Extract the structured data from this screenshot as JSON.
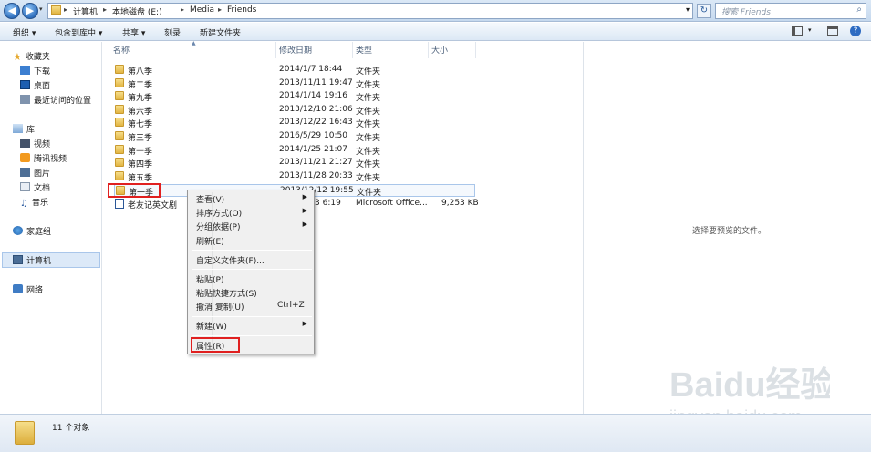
{
  "address": {
    "breadcrumbs": [
      "计算机",
      "本地磁盘 (E:)",
      "Media",
      "Friends"
    ],
    "search_placeholder": "搜索 Friends"
  },
  "toolbar": {
    "organize": "组织 ▾",
    "include": "包含到库中 ▾",
    "share": "共享 ▾",
    "burn": "刻录",
    "new_folder": "新建文件夹"
  },
  "nav": {
    "favorites": "收藏夹",
    "downloads": "下载",
    "desktop": "桌面",
    "recent": "最近访问的位置",
    "libraries": "库",
    "videos": "视频",
    "tencent_video": "腾讯视频",
    "pictures": "图片",
    "documents": "文档",
    "music": "音乐",
    "homegroup": "家庭组",
    "computer": "计算机",
    "network": "网络"
  },
  "columns": {
    "name": "名称",
    "modified": "修改日期",
    "type": "类型",
    "size": "大小"
  },
  "files": [
    {
      "name": "第八季",
      "date": "2014/1/7 18:44",
      "type": "文件夹",
      "size": ""
    },
    {
      "name": "第二季",
      "date": "2013/11/11 19:47",
      "type": "文件夹",
      "size": ""
    },
    {
      "name": "第九季",
      "date": "2014/1/14 19:16",
      "type": "文件夹",
      "size": ""
    },
    {
      "name": "第六季",
      "date": "2013/12/10 21:06",
      "type": "文件夹",
      "size": ""
    },
    {
      "name": "第七季",
      "date": "2013/12/22 16:43",
      "type": "文件夹",
      "size": ""
    },
    {
      "name": "第三季",
      "date": "2016/5/29 10:50",
      "type": "文件夹",
      "size": ""
    },
    {
      "name": "第十季",
      "date": "2014/1/25 21:07",
      "type": "文件夹",
      "size": ""
    },
    {
      "name": "第四季",
      "date": "2013/11/21 21:27",
      "type": "文件夹",
      "size": ""
    },
    {
      "name": "第五季",
      "date": "2013/11/28 20:33",
      "type": "文件夹",
      "size": ""
    },
    {
      "name": "第一季",
      "date": "2013/12/12 19:55",
      "type": "文件夹",
      "size": ""
    },
    {
      "name": "老友记英文剧",
      "date": "3 6:19",
      "type": "Microsoft Office...",
      "size": "9,253 KB"
    }
  ],
  "context_menu": {
    "view": "查看(V)",
    "sort": "排序方式(O)",
    "group": "分组依据(P)",
    "refresh": "刷新(E)",
    "customize": "自定义文件夹(F)...",
    "paste": "粘贴(P)",
    "paste_shortcut": "粘贴快捷方式(S)",
    "undo": "撤消 复制(U)",
    "undo_shortcut": "Ctrl+Z",
    "new": "新建(W)",
    "properties": "属性(R)"
  },
  "preview": {
    "text": "选择要预览的文件。"
  },
  "status": {
    "count": "11 个对象"
  },
  "watermark": {
    "brand": "Baidu经验",
    "url": "jingyan.baidu.com"
  }
}
